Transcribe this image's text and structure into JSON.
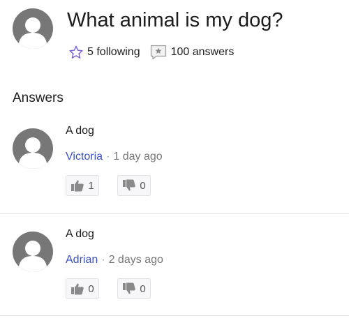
{
  "question": {
    "title": "What animal is my dog?",
    "following": "5 following",
    "answers_count": "100 answers"
  },
  "answers_section": {
    "label": "Answers"
  },
  "answers": [
    {
      "text": "A dog",
      "author": "Victoria",
      "separator": "·",
      "time": "1 day ago",
      "upvotes": "1",
      "downvotes": "0"
    },
    {
      "text": "A dog",
      "author": "Adrian",
      "separator": "·",
      "time": "2 days ago",
      "upvotes": "0",
      "downvotes": "0"
    }
  ],
  "colors": {
    "accent": "#3a52c4",
    "star": "#7b61d6",
    "avatar": "#777777",
    "meta_gray": "#777777"
  },
  "icons": {
    "avatar": "user-avatar-icon",
    "follow": "star-outline-icon",
    "answers": "answer-star-box-icon",
    "upvote": "thumbs-up-icon",
    "downvote": "thumbs-down-icon"
  }
}
